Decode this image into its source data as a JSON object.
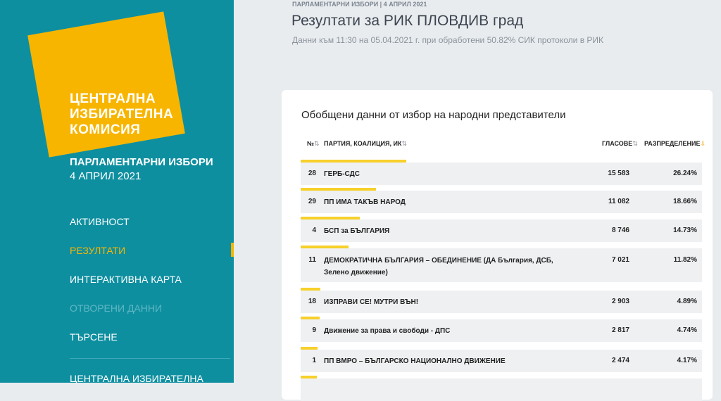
{
  "sidebar": {
    "logo_lines": [
      "ЦЕНТРАЛНА",
      "ИЗБИРАТЕЛНА",
      "КОМИСИЯ"
    ],
    "election_title": "ПАРЛАМЕНТАРНИ ИЗБОРИ",
    "election_date": "4 АПРИЛ 2021",
    "nav": [
      {
        "label": "АКТИВНОСТ",
        "state": "normal"
      },
      {
        "label": "РЕЗУЛТАТИ",
        "state": "active"
      },
      {
        "label": "ИНТЕРАКТИВНА КАРТА",
        "state": "normal"
      },
      {
        "label": "ОТВОРЕНИ ДАННИ",
        "state": "disabled"
      },
      {
        "label": "ТЪРСЕНЕ",
        "state": "normal"
      },
      {
        "label": "ЦЕНТРАЛНА ИЗБИРАТЕЛНА",
        "state": "normal"
      }
    ],
    "colors": {
      "background": "#0e8fa0",
      "accent": "#f7b500"
    }
  },
  "header": {
    "breadcrumb": "ПАРЛАМЕНТАРНИ ИЗБОРИ | 4 АПРИЛ 2021",
    "title": "Резултати за РИК ПЛОВДИВ град",
    "subtitle": "Данни към 11:30 на 05.04.2021 г. при обработени 50.82% СИК протоколи в РИК"
  },
  "results": {
    "title": "Обобщени данни от избор на народни представители",
    "columns": {
      "number": "№",
      "party": "ПАРТИЯ, КОАЛИЦИЯ, ИК",
      "votes": "ГЛАСОВЕ",
      "share": "РАЗПРЕДЕЛЕНИЕ"
    },
    "rows": [
      {
        "number": "28",
        "party": "ГЕРБ-СДС",
        "votes": "15 583",
        "share": "26.24%"
      },
      {
        "number": "29",
        "party": "ПП ИМА ТАКЪВ НАРОД",
        "votes": "11 082",
        "share": "18.66%"
      },
      {
        "number": "4",
        "party": "БСП за БЪЛГАРИЯ",
        "votes": "8 746",
        "share": "14.73%"
      },
      {
        "number": "11",
        "party": "ДЕМОКРАТИЧНА БЪЛГАРИЯ – ОБЕДИНЕНИЕ (ДА България, ДСБ, Зелено движение)",
        "votes": "7 021",
        "share": "11.82%"
      },
      {
        "number": "18",
        "party": "ИЗПРАВИ СЕ! МУТРИ ВЪН!",
        "votes": "2 903",
        "share": "4.89%"
      },
      {
        "number": "9",
        "party": "Движение за права и свободи - ДПС",
        "votes": "2 817",
        "share": "4.74%"
      },
      {
        "number": "1",
        "party": "ПП ВМРО – БЪЛГАРСКО НАЦИОНАЛНО ДВИЖЕНИЕ",
        "votes": "2 474",
        "share": "4.17%"
      }
    ],
    "bar_color": "#f7d02a"
  }
}
